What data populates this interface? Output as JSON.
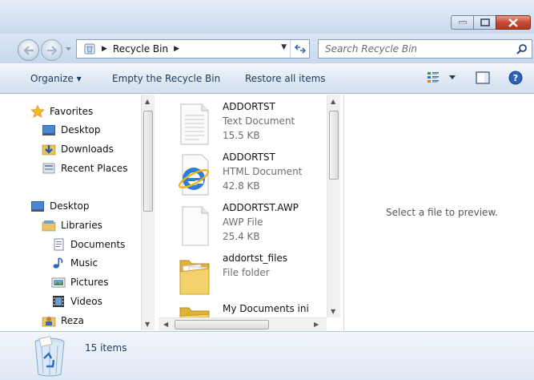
{
  "address": {
    "crumbs": [
      "Recycle Bin"
    ],
    "search_placeholder": "Search Recycle Bin"
  },
  "toolbar": {
    "organize": "Organize ▾",
    "empty": "Empty the Recycle Bin",
    "restore": "Restore all items"
  },
  "nav": {
    "favorites": "Favorites",
    "desktop_fav": "Desktop",
    "downloads": "Downloads",
    "recent": "Recent Places",
    "desktop": "Desktop",
    "libraries": "Libraries",
    "documents": "Documents",
    "music": "Music",
    "pictures": "Pictures",
    "videos": "Videos",
    "user": "Reza"
  },
  "files": [
    {
      "name": "ADDORTST",
      "type": "Text Document",
      "size": "15.5 KB",
      "icon": "text-document-icon"
    },
    {
      "name": "ADDORTST",
      "type": "HTML Document",
      "size": "42.8 KB",
      "icon": "internet-explorer-icon"
    },
    {
      "name": "ADDORTST.AWP",
      "type": "AWP File",
      "size": "25.4 KB",
      "icon": "blank-file-icon"
    },
    {
      "name": "addortst_files",
      "type": "File folder",
      "size": "",
      "icon": "folder-icon"
    },
    {
      "name": "My Documents ini",
      "type": "",
      "size": "",
      "icon": "folder-icon"
    }
  ],
  "preview": {
    "message": "Select a file to preview."
  },
  "details": {
    "count": "15 items"
  },
  "colors": {
    "accent": "#1e395b",
    "close": "#c64a34",
    "folder": "#f0c84a"
  }
}
